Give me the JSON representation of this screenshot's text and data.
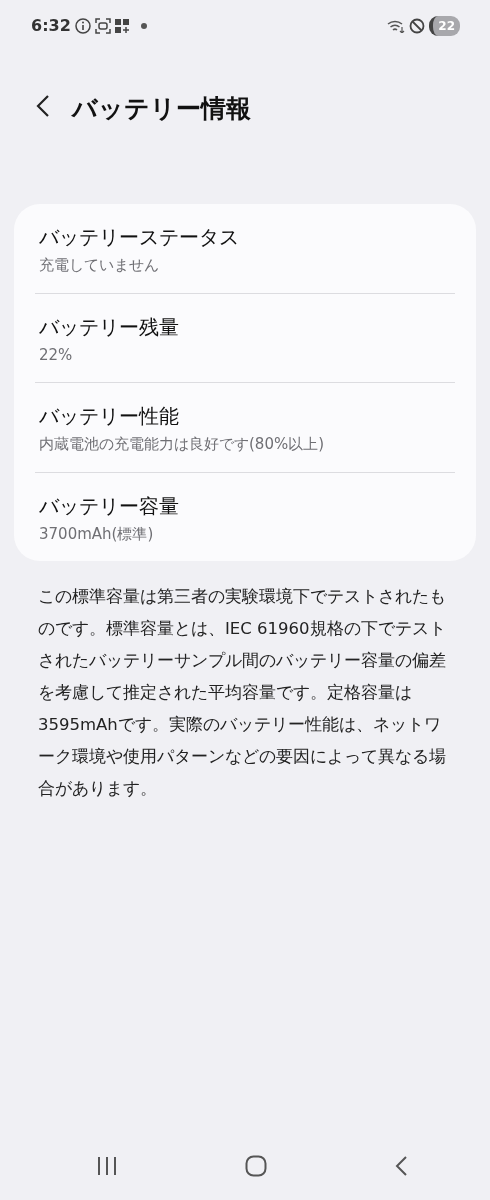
{
  "status_bar": {
    "time": "6:32",
    "battery": "22"
  },
  "header": {
    "title": "バッテリー情報"
  },
  "items": [
    {
      "title": "バッテリーステータス",
      "value": "充電していません"
    },
    {
      "title": "バッテリー残量",
      "value": "22%"
    },
    {
      "title": "バッテリー性能",
      "value": "内蔵電池の充電能力は良好です(80%以上)"
    },
    {
      "title": "バッテリー容量",
      "value": "3700mAh(標準)"
    }
  ],
  "note": "この標準容量は第三者の実験環境下でテストされたものです。標準容量とは、IEC 61960規格の下でテストされたバッテリーサンプル間のバッテリー容量の偏差を考慮して推定された平均容量です。定格容量は3595mAhです。実際のバッテリー性能は、ネットワーク環境や使用パターンなどの要因によって異なる場合があります。"
}
